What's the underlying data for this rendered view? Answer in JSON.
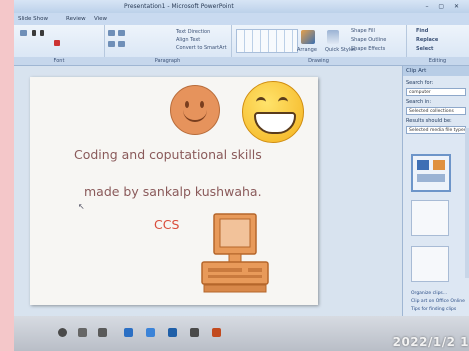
{
  "window": {
    "title": "Presentation1 - Microsoft PowerPoint",
    "controls": "– ▢ ✕"
  },
  "menubar": {
    "items": [
      "Slide Show",
      "Review",
      "View"
    ]
  },
  "ribbon": {
    "groups": [
      "Font",
      "Paragraph",
      "Drawing",
      "Editing"
    ],
    "paragraph_items": [
      "Text Direction",
      "Align Text",
      "Convert to SmartArt"
    ],
    "drawing": {
      "arrange": "Arrange",
      "quick_styles": "Quick Styles",
      "shape_fill": "Shape Fill",
      "shape_outline": "Shape Outline",
      "shape_effects": "Shape Effects"
    },
    "editing": {
      "find": "Find",
      "replace": "Replace",
      "select": "Select"
    }
  },
  "slide": {
    "line1": "Coding and coputational skills",
    "line2": "made by sankalp kushwaha.",
    "line3": "CCS"
  },
  "clip_art_pane": {
    "header": "Clip Art",
    "search_for_label": "Search for:",
    "search_for_value": "computer",
    "search_in_label": "Search in:",
    "search_in_value": "Selected collections",
    "results_label": "Results should be:",
    "results_value": "Selected media file types",
    "links": [
      "Organize clips...",
      "Clip art on Office Online",
      "Tips for finding clips"
    ]
  },
  "taskbar": {
    "clock": "2022/1/2 1"
  },
  "colors": {
    "slide_text": "#8a5a5a",
    "slide_accent": "#d94c3a",
    "ribbon": "#d6e4f4",
    "border": "#f4c7c9"
  }
}
